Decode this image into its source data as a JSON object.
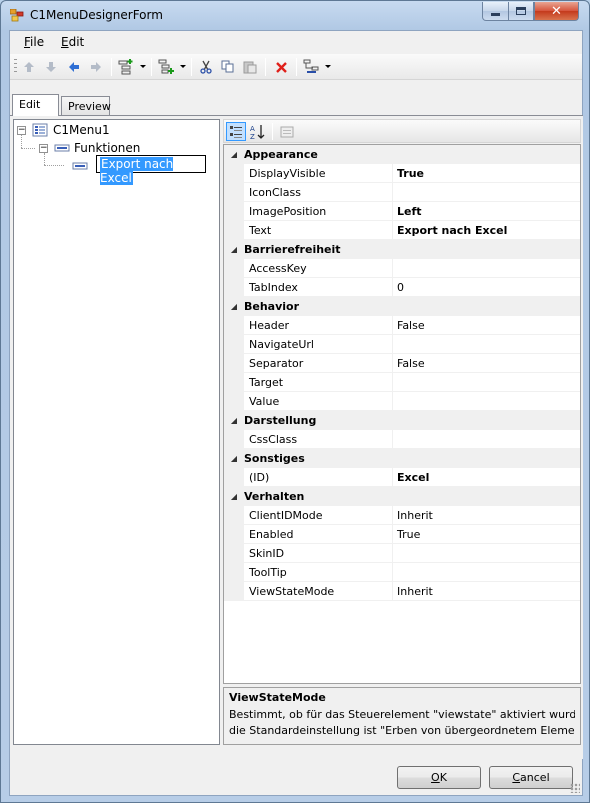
{
  "window": {
    "title": "C1MenuDesignerForm"
  },
  "menu": [
    {
      "label": "File",
      "underline": "F",
      "rest": "ile"
    },
    {
      "label": "Edit",
      "underline": "E",
      "rest": "dit"
    }
  ],
  "toolbar_icons": [
    "move-up-icon",
    "move-down-icon",
    "move-left-icon",
    "move-right-icon",
    "insert-item-icon",
    "add-child-icon",
    "cut-icon",
    "copy-icon",
    "paste-icon",
    "delete-icon",
    "change-type-icon"
  ],
  "tabs": [
    {
      "label": "Edit",
      "active": true
    },
    {
      "label": "Preview",
      "active": false
    }
  ],
  "tree": {
    "root": "C1Menu1",
    "child": "Funktionen",
    "editing_value": "Export nach Excel"
  },
  "property_grid": {
    "categories": [
      {
        "name": "Appearance",
        "props": [
          {
            "name": "DisplayVisible",
            "value": "True",
            "bold": true
          },
          {
            "name": "IconClass",
            "value": ""
          },
          {
            "name": "ImagePosition",
            "value": "Left",
            "bold": true
          },
          {
            "name": "Text",
            "value": "Export nach Excel",
            "bold": true
          }
        ]
      },
      {
        "name": "Barrierefreiheit",
        "props": [
          {
            "name": "AccessKey",
            "value": ""
          },
          {
            "name": "TabIndex",
            "value": "0"
          }
        ]
      },
      {
        "name": "Behavior",
        "props": [
          {
            "name": "Header",
            "value": "False"
          },
          {
            "name": "NavigateUrl",
            "value": ""
          },
          {
            "name": "Separator",
            "value": "False"
          },
          {
            "name": "Target",
            "value": ""
          },
          {
            "name": "Value",
            "value": ""
          }
        ]
      },
      {
        "name": "Darstellung",
        "props": [
          {
            "name": "CssClass",
            "value": ""
          }
        ]
      },
      {
        "name": "Sonstiges",
        "props": [
          {
            "name": "(ID)",
            "value": "Excel",
            "bold": true
          }
        ]
      },
      {
        "name": "Verhalten",
        "props": [
          {
            "name": "ClientIDMode",
            "value": "Inherit"
          },
          {
            "name": "Enabled",
            "value": "True"
          },
          {
            "name": "SkinID",
            "value": ""
          },
          {
            "name": "ToolTip",
            "value": ""
          },
          {
            "name": "ViewStateMode",
            "value": "Inherit"
          }
        ]
      }
    ],
    "description_title": "ViewStateMode",
    "description_lines": [
      "Bestimmt, ob für das Steuerelement \"viewstate\" aktiviert wurde,",
      "die Standardeinstellung ist \"Erben von übergeordnetem Elemen..."
    ]
  },
  "buttons": {
    "ok": {
      "label": "OK",
      "underline": "O",
      "rest": "K"
    },
    "cancel": {
      "label": "Cancel",
      "underline": "C",
      "rest": "ancel"
    }
  }
}
